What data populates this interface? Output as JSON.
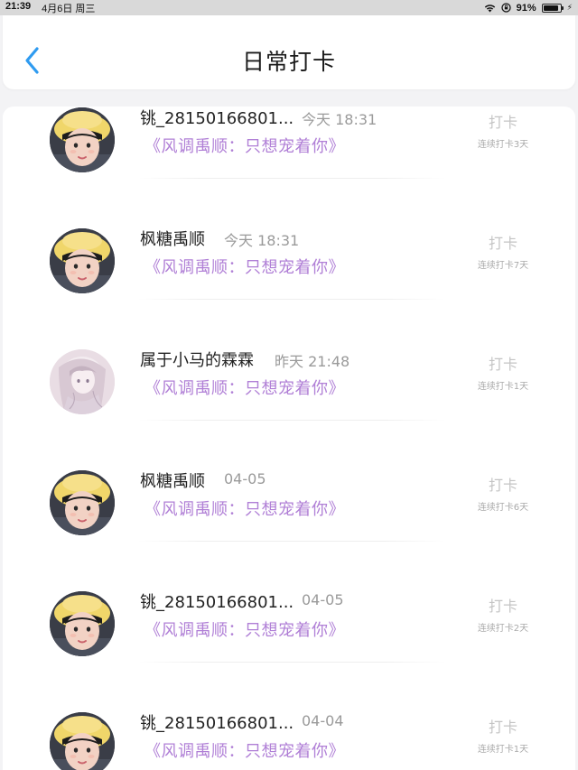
{
  "status_bar": {
    "time": "21:39",
    "date": "4月6日 周三",
    "battery": "91%"
  },
  "header": {
    "title": "日常打卡",
    "accent_color": "#2f9bf0"
  },
  "colors": {
    "work_title": "#b07fd6",
    "meta": "#9a9a9a"
  },
  "entries": [
    {
      "name": "铫_28150166801...",
      "time": "今天 18:31",
      "work": "《风调禹顺：只想宠着你》",
      "action": "打卡",
      "streak": "连续打卡3天",
      "avatar": "yellow-hat-boy-avatar"
    },
    {
      "name": "枫糖禹顺",
      "time": "今天 18:31",
      "work": "《风调禹顺：只想宠着你》",
      "action": "打卡",
      "streak": "连续打卡7天",
      "avatar": "yellow-hat-boy-avatar"
    },
    {
      "name": "属于小马的霖霖",
      "time": "昨天 21:48",
      "work": "《风调禹顺：只想宠着你》",
      "action": "打卡",
      "streak": "连续打卡1天",
      "avatar": "anime-girl-avatar"
    },
    {
      "name": "枫糖禹顺",
      "time": "04-05",
      "work": "《风调禹顺：只想宠着你》",
      "action": "打卡",
      "streak": "连续打卡6天",
      "avatar": "yellow-hat-boy-avatar"
    },
    {
      "name": "铫_28150166801...",
      "time": "04-05",
      "work": "《风调禹顺：只想宠着你》",
      "action": "打卡",
      "streak": "连续打卡2天",
      "avatar": "yellow-hat-boy-avatar"
    },
    {
      "name": "铫_28150166801...",
      "time": "04-04",
      "work": "《风调禹顺：只想宠着你》",
      "action": "打卡",
      "streak": "连续打卡1天",
      "avatar": "yellow-hat-boy-avatar"
    }
  ]
}
